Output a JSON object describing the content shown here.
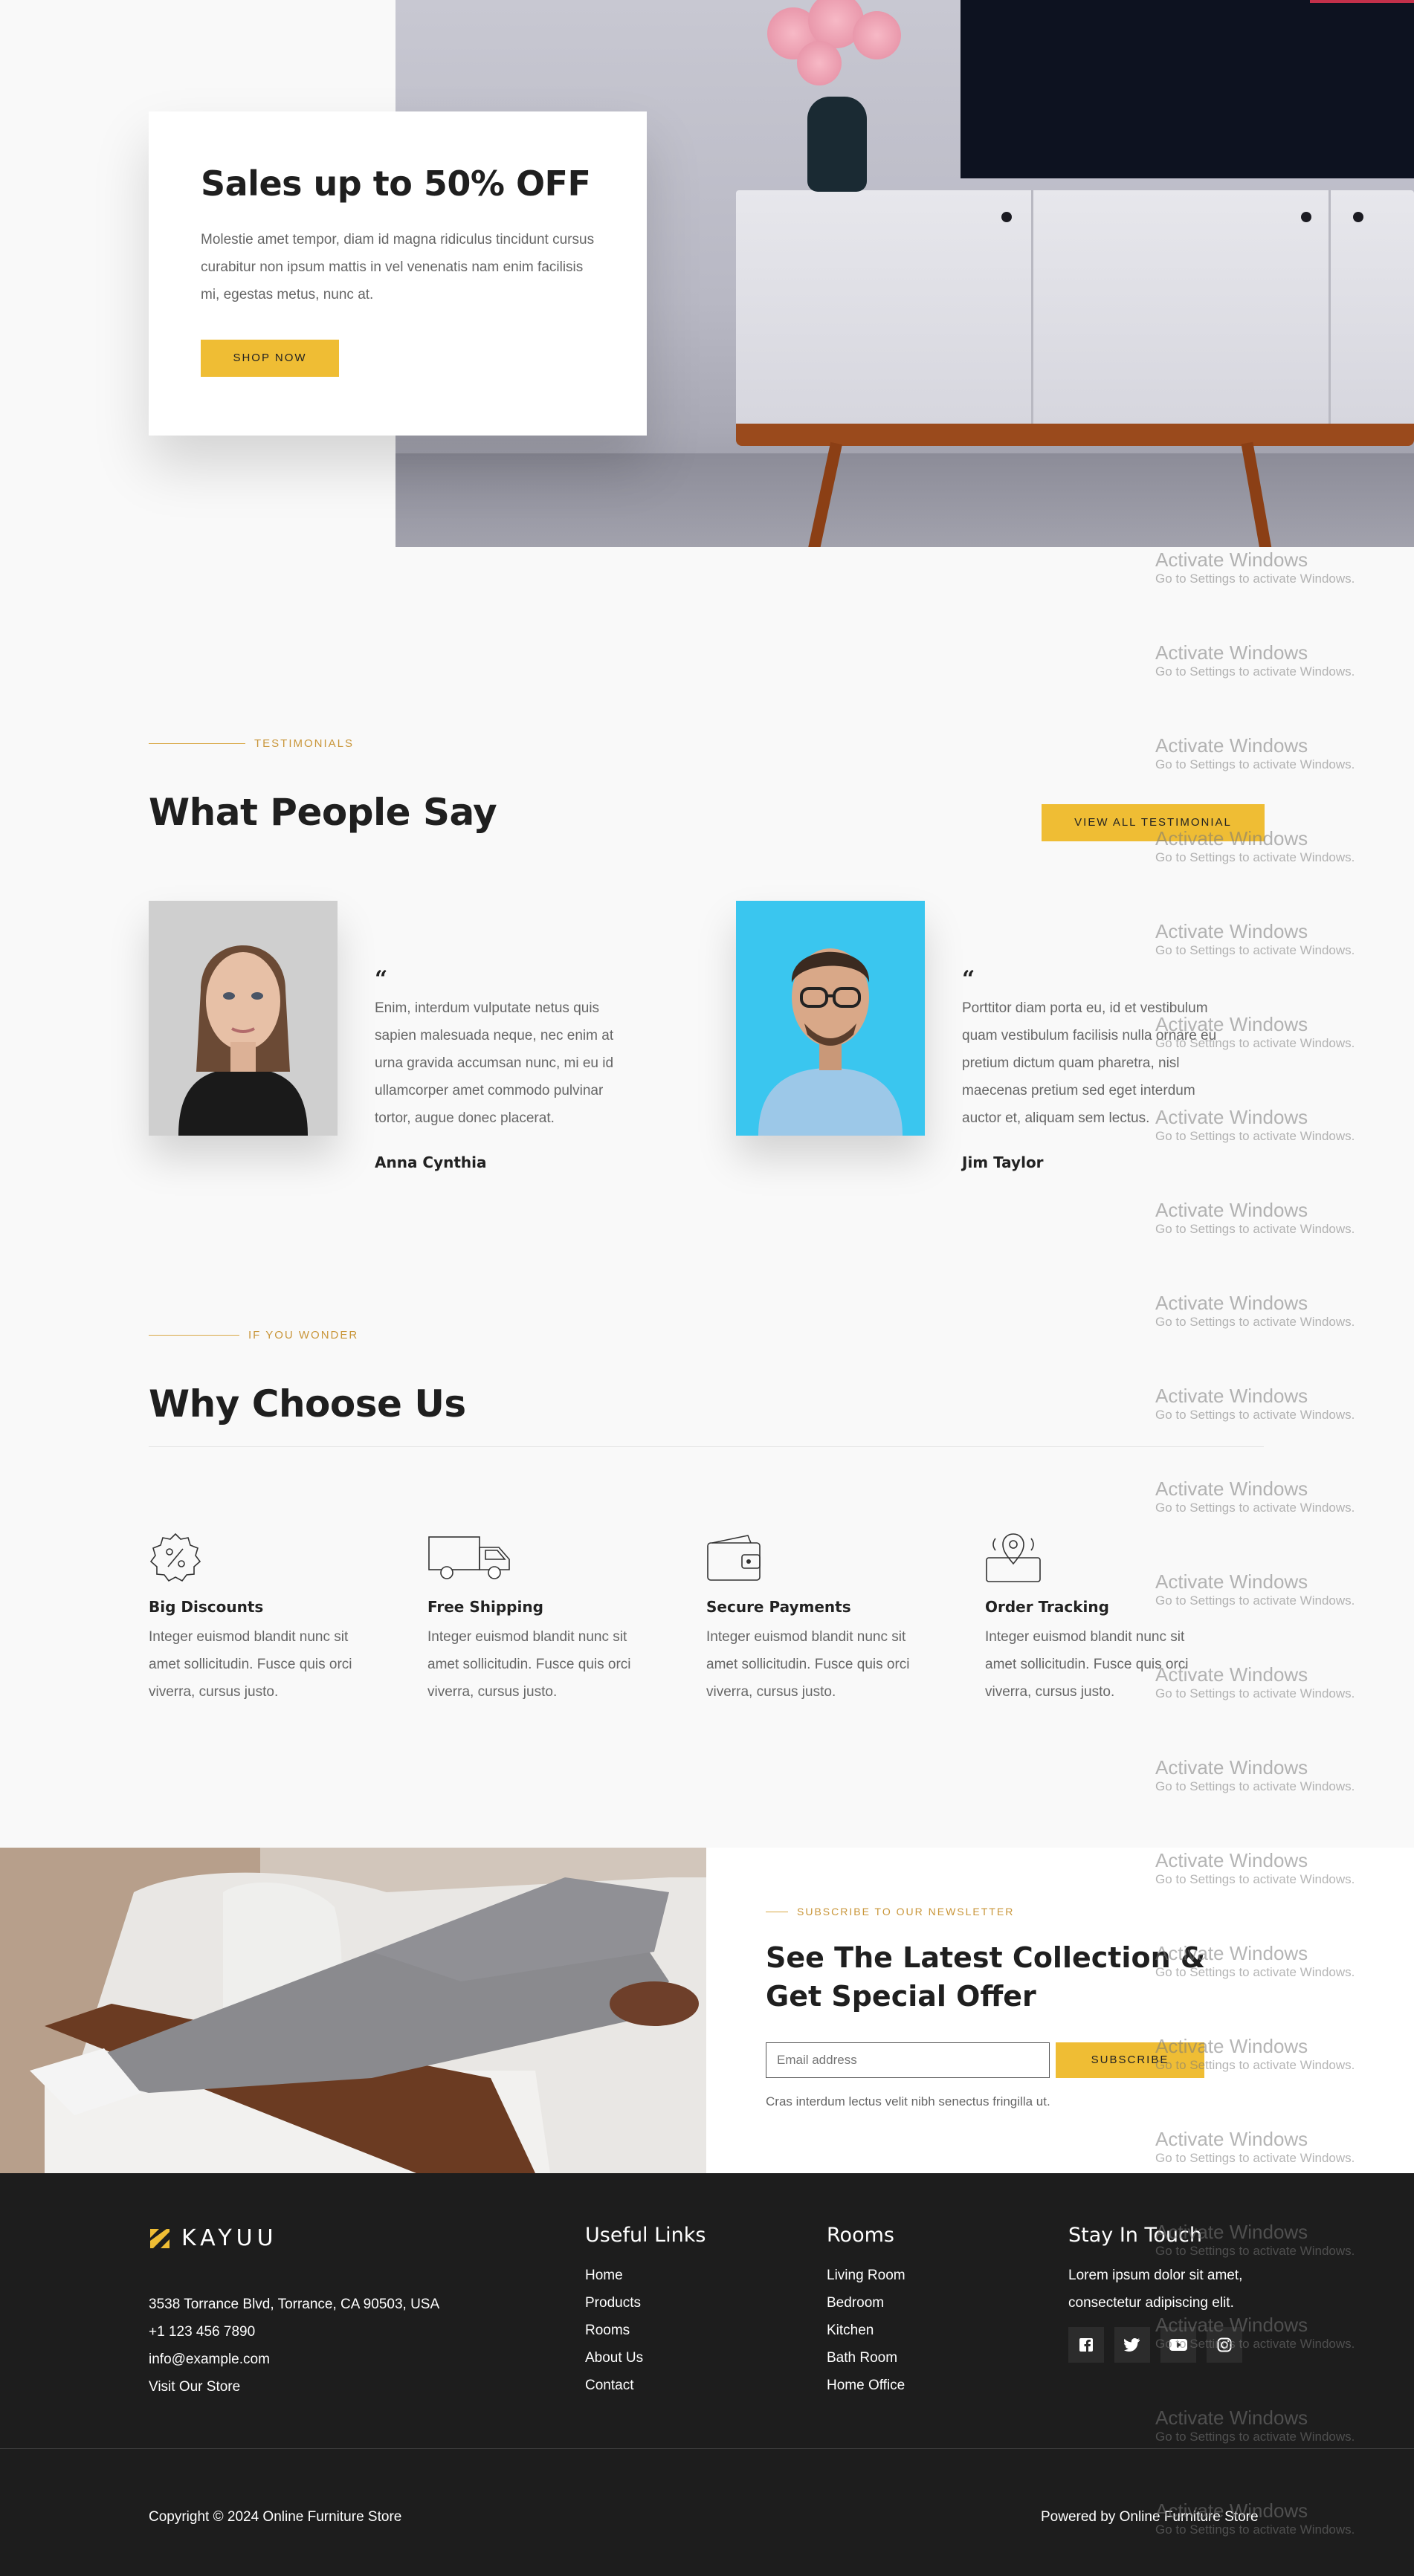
{
  "hero": {
    "title": "Sales up to 50% OFF",
    "text": "Molestie amet tempor, diam id magna ridiculus tincidunt cursus curabitur non ipsum mattis in vel venenatis nam enim facilisis mi, egestas metus, nunc at.",
    "button": "SHOP NOW"
  },
  "testimonials": {
    "eyebrow": "TESTIMONIALS",
    "title": "What People Say",
    "view_all": "VIEW ALL TESTIMONIAL",
    "quote_mark": "“",
    "items": [
      {
        "text": "Enim, interdum vulputate netus quis sapien malesuada neque, nec enim at urna gravida accumsan nunc, mi eu id ullamcorper amet commodo pulvinar tortor, augue donec placerat.",
        "name": "Anna Cynthia"
      },
      {
        "text": "Porttitor diam porta eu, id et vestibulum quam vestibulum facilisis nulla ornare eu pretium dictum quam pharetra, nisl maecenas pretium sed eget interdum auctor et, aliquam sem lectus.",
        "name": "Jim Taylor"
      }
    ]
  },
  "why": {
    "eyebrow": "IF YOU WONDER",
    "title": "Why Choose Us",
    "features": [
      {
        "icon": "discount-badge-icon",
        "title": "Big Discounts",
        "text": "Integer euismod blandit nunc sit amet sollicitudin. Fusce quis orci viverra, cursus justo."
      },
      {
        "icon": "delivery-truck-icon",
        "title": "Free Shipping",
        "text": "Integer euismod blandit nunc sit amet sollicitudin. Fusce quis orci viverra, cursus justo."
      },
      {
        "icon": "wallet-icon",
        "title": "Secure Payments",
        "text": "Integer euismod blandit nunc sit amet sollicitudin. Fusce quis orci viverra, cursus justo."
      },
      {
        "icon": "location-pin-icon",
        "title": "Order Tracking",
        "text": "Integer euismod blandit nunc sit amet sollicitudin. Fusce quis orci viverra, cursus justo."
      }
    ]
  },
  "newsletter": {
    "eyebrow": "SUBSCRIBE TO OUR NEWSLETTER",
    "title": "See The Latest Collection & Get Special Offer",
    "placeholder": "Email address",
    "button": "SUBSCRIBE",
    "note": "Cras interdum lectus velit nibh senectus fringilla ut."
  },
  "footer": {
    "brand": "KAYUU",
    "address": "3538 Torrance Blvd, Torrance, CA 90503, USA",
    "phone": "+1 123 456 7890",
    "email": "info@example.com",
    "store": "Visit Our Store",
    "useful_links_title": "Useful Links",
    "useful_links": [
      "Home",
      "Products",
      "Rooms",
      "About Us",
      "Contact"
    ],
    "rooms_title": "Rooms",
    "rooms": [
      "Living Room",
      "Bedroom",
      "Kitchen",
      "Bath Room",
      "Home Office"
    ],
    "touch_title": "Stay In Touch",
    "touch_text": "Lorem ipsum dolor sit amet, consectetur adipiscing elit.",
    "social_icons": [
      "facebook-icon",
      "twitter-icon",
      "youtube-icon",
      "instagram-icon"
    ],
    "copyright": "Copyright © 2024 Online Furniture Store",
    "powered": "Powered by Online Furniture Store"
  },
  "watermark": {
    "title": "Activate Windows",
    "subtitle": "Go to Settings to activate Windows."
  },
  "colors": {
    "accent": "#efbd34",
    "eyebrow": "#c9963a",
    "footer_bg": "#1d1d1d",
    "page_bg": "#f9f9f9"
  }
}
